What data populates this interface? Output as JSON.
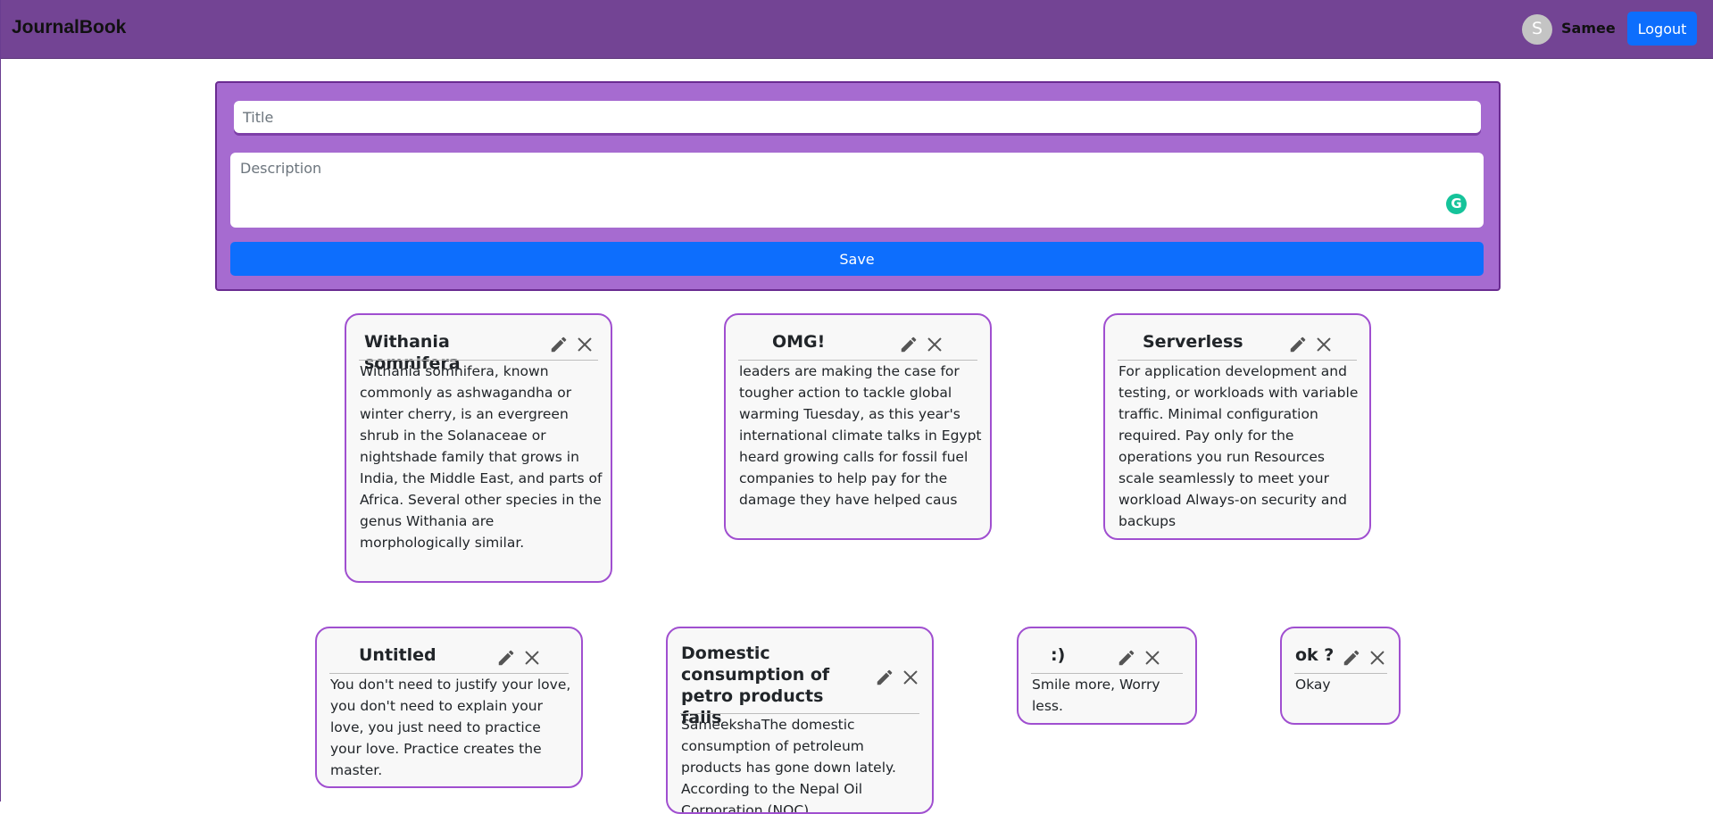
{
  "app": {
    "brand": "JournalBook"
  },
  "user": {
    "initial": "S",
    "name": "Samee",
    "logout_label": "Logout"
  },
  "form": {
    "title_placeholder": "Title",
    "description_placeholder": "Description",
    "save_label": "Save",
    "grammarly_glyph": "G"
  },
  "notes": [
    {
      "title": "Withania somnifera",
      "body": "Withania somnifera, known commonly as ashwagandha or winter cherry, is an evergreen shrub in the Solanaceae or nightshade family that grows in India, the Middle East, and parts of Africa. Several other species in the genus Withania are morphologically similar."
    },
    {
      "title": "OMG!",
      "body": "leaders are making the case for tougher action to tackle global warming Tuesday, as this year's international climate talks in Egypt heard growing calls for fossil fuel companies to help pay for the damage they have helped caus"
    },
    {
      "title": "Serverless",
      "body": "For application development and testing, or workloads with variable traffic. Minimal configuration required. Pay only for the operations you run Resources scale seamlessly to meet your workload Always-on security and backups"
    },
    {
      "title": "Untitled",
      "body": "You don't need to justify your love, you don't need to explain your love, you just need to practice your love. Practice creates the master."
    },
    {
      "title": "Domestic consumption of petro products falls",
      "body": "SameekshaThe domestic consumption of petroleum products has gone down lately. According to the Nepal Oil Corporation (NOC),"
    },
    {
      "title": ":)",
      "body": "Smile more, Worry less."
    },
    {
      "title": "ok ?",
      "body": "Okay"
    }
  ],
  "colors": {
    "navbar": "#734494",
    "form_background": "#a66bd0",
    "card_border": "#a04fd0",
    "button_primary": "#0d6efd"
  }
}
